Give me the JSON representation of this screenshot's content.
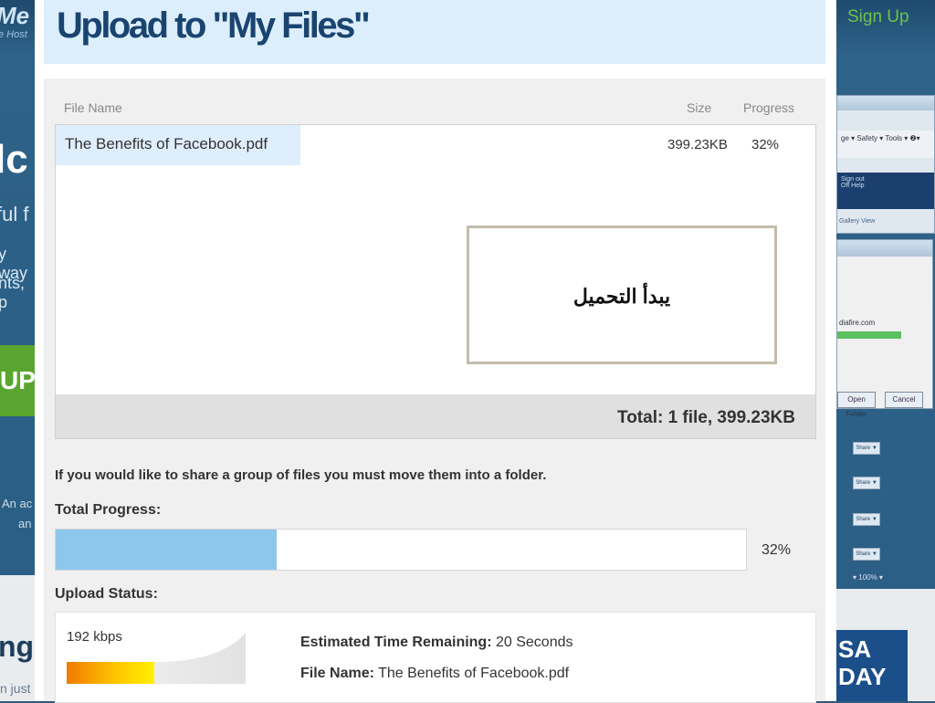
{
  "background": {
    "left_fragments": {
      "logo": "Me",
      "logo_sub": "e Host",
      "headline": "lc",
      "subline": "ful f",
      "line1": "y way",
      "line2": "nts, p",
      "button": "UP",
      "ac1": "An ac",
      "ac2": "an",
      "ng": "ng",
      "just": "n just"
    },
    "right_fragments": {
      "signup": "Sign Up",
      "toolbar": "ge ▾ Safety ▾ Tools ▾ ❷▾",
      "signout": "Sign out",
      "help": "Off   Help",
      "gallery": "Gallery View",
      "domain": "diafire.com",
      "open_folder": "Open Folder",
      "cancel": "Cancel",
      "share": "Share ▼",
      "zoom": "▾ 100% ▾",
      "ad": "SA DAY"
    }
  },
  "dialog": {
    "title": "Upload to \"My Files\"",
    "columns": {
      "name": "File Name",
      "size": "Size",
      "progress": "Progress"
    },
    "file": {
      "name": "The Benefits of Facebook.pdf",
      "size": "399.23KB",
      "progress": "32%"
    },
    "callout": "يبدأ التحميل",
    "total": "Total: 1 file, 399.23KB",
    "share_note": "If you would like to share a group of files you must move them into a folder.",
    "total_progress_label": "Total Progress:",
    "total_progress_value": 0.32,
    "total_progress_text": "32%",
    "upload_status_label": "Upload Status:",
    "speed": "192 kbps",
    "eta_label": "Estimated Time Remaining:",
    "eta_value": " 20 Seconds",
    "file_name_label": "File Name:",
    "file_name_value": " The Benefits of Facebook.pdf"
  },
  "colors": {
    "title": "#1a4470",
    "header_bg": "#dceefc",
    "progress_fill": "#8ec7ec"
  }
}
